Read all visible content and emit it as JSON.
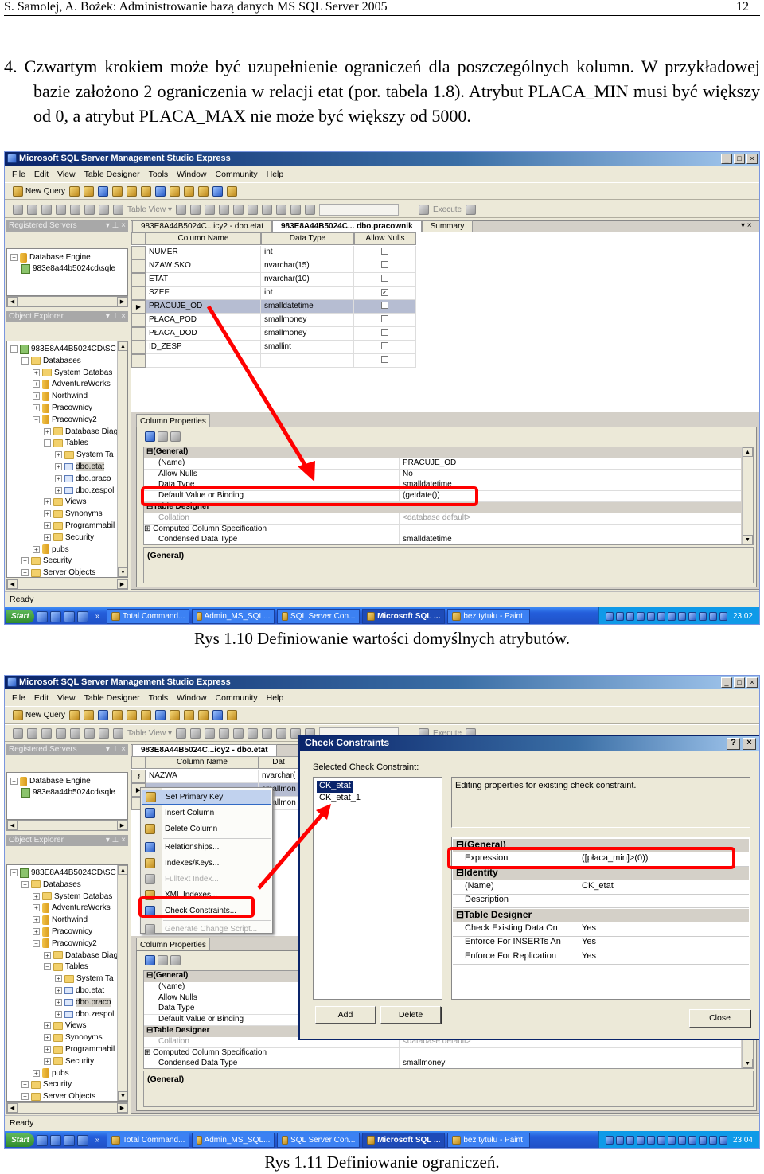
{
  "header": {
    "running": "S. Samolej, A. Bożek: Administrowanie bazą danych MS SQL Server 2005",
    "page": "12"
  },
  "paragraph": "4. Czwartym krokiem może być uzupełnienie ograniczeń dla poszczególnych kolumn. W przykładowej bazie założono 2 ograniczenia w relacji etat (por. tabela 1.8). Atrybut PLACA_MIN musi być większy od 0, a atrybut PLACA_MAX nie może być większy od 5000.",
  "colors": {
    "highlight": "#ff0000",
    "titlebar": "#0a246a",
    "taskbar": "#245edb"
  },
  "figures": [
    {
      "caption": "Rys 1.10 Definiowanie wartości domyślnych atrybutów.",
      "window": {
        "title": "Microsoft SQL Server Management Studio Express",
        "controls": [
          "_",
          "□",
          "×"
        ],
        "menu": [
          "File",
          "Edit",
          "View",
          "Table Designer",
          "Tools",
          "Window",
          "Community",
          "Help"
        ],
        "toolbar1": {
          "new_query": "New Query"
        },
        "toolbar2": {
          "table_view": "Table View ▾",
          "execute": "Execute"
        },
        "registered_servers": {
          "title": "Registered Servers",
          "controls": "▾ ⊥ ×",
          "items": [
            "Database Engine",
            "983e8a44b5024cd\\sqle"
          ]
        },
        "object_explorer": {
          "title": "Object Explorer",
          "controls": "▾ ⊥ ×",
          "tree": [
            {
              "label": "983E8A44B5024CD\\SC",
              "level": 0,
              "exp": "⊟",
              "icon": "srv"
            },
            {
              "label": "Databases",
              "level": 1,
              "exp": "⊟",
              "icon": "fold"
            },
            {
              "label": "System Databas",
              "level": 2,
              "exp": "⊞",
              "icon": "fold"
            },
            {
              "label": "AdventureWorks",
              "level": 2,
              "exp": "⊞",
              "icon": "db"
            },
            {
              "label": "Northwind",
              "level": 2,
              "exp": "⊞",
              "icon": "db"
            },
            {
              "label": "Pracownicy",
              "level": 2,
              "exp": "⊞",
              "icon": "db"
            },
            {
              "label": "Pracownicy2",
              "level": 2,
              "exp": "⊟",
              "icon": "db"
            },
            {
              "label": "Database Diag",
              "level": 3,
              "exp": "⊞",
              "icon": "fold"
            },
            {
              "label": "Tables",
              "level": 3,
              "exp": "⊟",
              "icon": "fold"
            },
            {
              "label": "System Ta",
              "level": 4,
              "exp": "⊞",
              "icon": "fold"
            },
            {
              "label": "dbo.etat",
              "level": 4,
              "exp": "⊞",
              "icon": "tbl",
              "selected": true
            },
            {
              "label": "dbo.praco",
              "level": 4,
              "exp": "⊞",
              "icon": "tbl"
            },
            {
              "label": "dbo.zespol",
              "level": 4,
              "exp": "⊞",
              "icon": "tbl"
            },
            {
              "label": "Views",
              "level": 3,
              "exp": "⊞",
              "icon": "fold"
            },
            {
              "label": "Synonyms",
              "level": 3,
              "exp": "⊞",
              "icon": "fold"
            },
            {
              "label": "Programmabil",
              "level": 3,
              "exp": "⊞",
              "icon": "fold"
            },
            {
              "label": "Security",
              "level": 3,
              "exp": "⊞",
              "icon": "fold"
            },
            {
              "label": "pubs",
              "level": 2,
              "exp": "⊞",
              "icon": "db"
            },
            {
              "label": "Security",
              "level": 1,
              "exp": "⊞",
              "icon": "fold"
            },
            {
              "label": "Server Objects",
              "level": 1,
              "exp": "⊞",
              "icon": "fold"
            }
          ]
        },
        "tabs": [
          {
            "label": "983E8A44B5024C...icy2 - dbo.etat",
            "active": false
          },
          {
            "label": "983E8A44B5024C... dbo.pracownik",
            "active": true
          },
          {
            "label": "Summary",
            "active": false
          }
        ],
        "tab_close": "▾ ×",
        "grid": {
          "headers": [
            "Column Name",
            "Data Type",
            "Allow Nulls"
          ],
          "rows": [
            {
              "name": "NUMER",
              "type": "int",
              "nulls": false
            },
            {
              "name": "NZAWISKO",
              "type": "nvarchar(15)",
              "nulls": false
            },
            {
              "name": "ETAT",
              "type": "nvarchar(10)",
              "nulls": false
            },
            {
              "name": "SZEF",
              "type": "int",
              "nulls": true
            },
            {
              "name": "PRACUJE_OD",
              "type": "smalldatetime",
              "nulls": false,
              "current": true
            },
            {
              "name": "PŁACA_POD",
              "type": "smallmoney",
              "nulls": false
            },
            {
              "name": "PŁACA_DOD",
              "type": "smallmoney",
              "nulls": false
            },
            {
              "name": "ID_ZESP",
              "type": "smallint",
              "nulls": false
            },
            {
              "name": "",
              "type": "",
              "nulls": false
            }
          ]
        },
        "column_properties": {
          "tab": "Column Properties",
          "rows": [
            {
              "group": "(General)"
            },
            {
              "key": "(Name)",
              "value": "PRACUJE_OD"
            },
            {
              "key": "Allow Nulls",
              "value": "No"
            },
            {
              "key": "Data Type",
              "value": "smalldatetime"
            },
            {
              "key": "Default Value or Binding",
              "value": "(getdate())"
            },
            {
              "group": "Table Designer"
            },
            {
              "key": "Collation",
              "value": "<database default>",
              "grey": true
            },
            {
              "key": "Computed Column Specification",
              "value": "",
              "expandable": true
            },
            {
              "key": "Condensed Data Type",
              "value": "smalldatetime"
            }
          ],
          "description": "(General)"
        },
        "status": "Ready",
        "taskbar": {
          "start": "Start",
          "more": "»",
          "buttons": [
            {
              "label": "Total Command...",
              "active": false
            },
            {
              "label": "Admin_MS_SQL...",
              "active": false
            },
            {
              "label": "SQL Server Con...",
              "active": false
            },
            {
              "label": "Microsoft SQL ...",
              "active": true
            },
            {
              "label": "bez tytułu - Paint",
              "active": false
            }
          ],
          "time": "23:02"
        }
      }
    },
    {
      "caption": "Rys 1.11 Definiowanie ograniczeń.",
      "window": {
        "title": "Microsoft SQL Server Management Studio Express",
        "controls": [
          "_",
          "□",
          "×"
        ],
        "menu": [
          "File",
          "Edit",
          "View",
          "Table Designer",
          "Tools",
          "Window",
          "Community",
          "Help"
        ],
        "toolbar1": {
          "new_query": "New Query"
        },
        "toolbar2": {
          "table_view": "Table View ▾",
          "execute": "Execute"
        },
        "registered_servers": {
          "title": "Registered Servers",
          "controls": "▾ ⊥ ×",
          "items": [
            "Database Engine",
            "983e8a44b5024cd\\sqle"
          ]
        },
        "object_explorer": {
          "title": "Object Explorer",
          "controls": "▾ ⊥ ×",
          "tree": [
            {
              "label": "983E8A44B5024CD\\SC",
              "level": 0,
              "exp": "⊟",
              "icon": "srv"
            },
            {
              "label": "Databases",
              "level": 1,
              "exp": "⊟",
              "icon": "fold"
            },
            {
              "label": "System Databas",
              "level": 2,
              "exp": "⊞",
              "icon": "fold"
            },
            {
              "label": "AdventureWorks",
              "level": 2,
              "exp": "⊞",
              "icon": "db"
            },
            {
              "label": "Northwind",
              "level": 2,
              "exp": "⊞",
              "icon": "db"
            },
            {
              "label": "Pracownicy",
              "level": 2,
              "exp": "⊞",
              "icon": "db"
            },
            {
              "label": "Pracownicy2",
              "level": 2,
              "exp": "⊟",
              "icon": "db"
            },
            {
              "label": "Database Diag",
              "level": 3,
              "exp": "⊞",
              "icon": "fold"
            },
            {
              "label": "Tables",
              "level": 3,
              "exp": "⊟",
              "icon": "fold"
            },
            {
              "label": "System Ta",
              "level": 4,
              "exp": "⊞",
              "icon": "fold"
            },
            {
              "label": "dbo.etat",
              "level": 4,
              "exp": "⊞",
              "icon": "tbl"
            },
            {
              "label": "dbo.praco",
              "level": 4,
              "exp": "⊞",
              "icon": "tbl",
              "selected": true
            },
            {
              "label": "dbo.zespol",
              "level": 4,
              "exp": "⊞",
              "icon": "tbl"
            },
            {
              "label": "Views",
              "level": 3,
              "exp": "⊞",
              "icon": "fold"
            },
            {
              "label": "Synonyms",
              "level": 3,
              "exp": "⊞",
              "icon": "fold"
            },
            {
              "label": "Programmabil",
              "level": 3,
              "exp": "⊞",
              "icon": "fold"
            },
            {
              "label": "Security",
              "level": 3,
              "exp": "⊞",
              "icon": "fold"
            },
            {
              "label": "pubs",
              "level": 2,
              "exp": "⊞",
              "icon": "db"
            },
            {
              "label": "Security",
              "level": 1,
              "exp": "⊞",
              "icon": "fold"
            },
            {
              "label": "Server Objects",
              "level": 1,
              "exp": "⊞",
              "icon": "fold"
            }
          ]
        },
        "tabs": [
          {
            "label": "983E8A44B5024C...icy2 - dbo.etat",
            "active": true
          }
        ],
        "tab_close": "",
        "grid": {
          "headers": [
            "Column Name",
            "Dat"
          ],
          "rows": [
            {
              "name": "NAZWA",
              "type": "nvarchar(",
              "key": true
            },
            {
              "name": "",
              "type": "smallmon",
              "current": true
            },
            {
              "name": "",
              "type": "smallmon"
            }
          ]
        },
        "context_menu": [
          {
            "label": "Set Primary Key",
            "icon": "key-icon",
            "highlighted": true
          },
          {
            "label": "Insert Column",
            "icon": "insert-column-icon"
          },
          {
            "label": "Delete Column",
            "icon": "delete-column-icon",
            "sep_after": true
          },
          {
            "label": "Relationships...",
            "icon": "relationships-icon"
          },
          {
            "label": "Indexes/Keys...",
            "icon": "indexes-icon"
          },
          {
            "label": "Fulltext Index...",
            "icon": "fulltext-icon",
            "disabled": true
          },
          {
            "label": "XML Indexes...",
            "icon": "xml-indexes-icon"
          },
          {
            "label": "Check Constraints...",
            "icon": "check-constraints-icon",
            "sep_after": true
          },
          {
            "label": "Generate Change Script...",
            "icon": "script-icon",
            "disabled": true
          }
        ],
        "column_properties": {
          "tab": "Column Properties",
          "rows": [
            {
              "group": "(General)"
            },
            {
              "key": "(Name)",
              "value": ""
            },
            {
              "key": "Allow Nulls",
              "value": ""
            },
            {
              "key": "Data Type",
              "value": ""
            },
            {
              "key": "Default Value or Binding",
              "value": ""
            },
            {
              "group": "Table Designer"
            },
            {
              "key": "Collation",
              "value": "<database default>",
              "grey": true
            },
            {
              "key": "Computed Column Specification",
              "value": "",
              "expandable": true
            },
            {
              "key": "Condensed Data Type",
              "value": "smallmoney"
            }
          ],
          "description": "(General)"
        },
        "dialog": {
          "title": "Check Constraints",
          "help": "?",
          "close_x": "×",
          "list_label": "Selected Check Constraint:",
          "constraints": [
            {
              "label": "CK_etat",
              "selected": true
            },
            {
              "label": "CK_etat_1",
              "selected": false
            }
          ],
          "description": "Editing properties for existing check constraint.",
          "properties": [
            {
              "group": "(General)"
            },
            {
              "key": "Expression",
              "value": "([płaca_min]>(0))"
            },
            {
              "group": "Identity"
            },
            {
              "key": "(Name)",
              "value": "CK_etat"
            },
            {
              "key": "Description",
              "value": ""
            },
            {
              "group": "Table Designer"
            },
            {
              "key": "Check Existing Data On",
              "value": "Yes"
            },
            {
              "key": "Enforce For INSERTs An",
              "value": "Yes"
            },
            {
              "key": "Enforce For Replication",
              "value": "Yes"
            }
          ],
          "add": "Add",
          "delete": "Delete",
          "close": "Close"
        },
        "status": "Ready",
        "taskbar": {
          "start": "Start",
          "more": "»",
          "buttons": [
            {
              "label": "Total Command...",
              "active": false
            },
            {
              "label": "Admin_MS_SQL...",
              "active": false
            },
            {
              "label": "SQL Server Con...",
              "active": false
            },
            {
              "label": "Microsoft SQL ...",
              "active": true
            },
            {
              "label": "bez tytułu - Paint",
              "active": false
            }
          ],
          "time": "23:04"
        }
      }
    }
  ]
}
